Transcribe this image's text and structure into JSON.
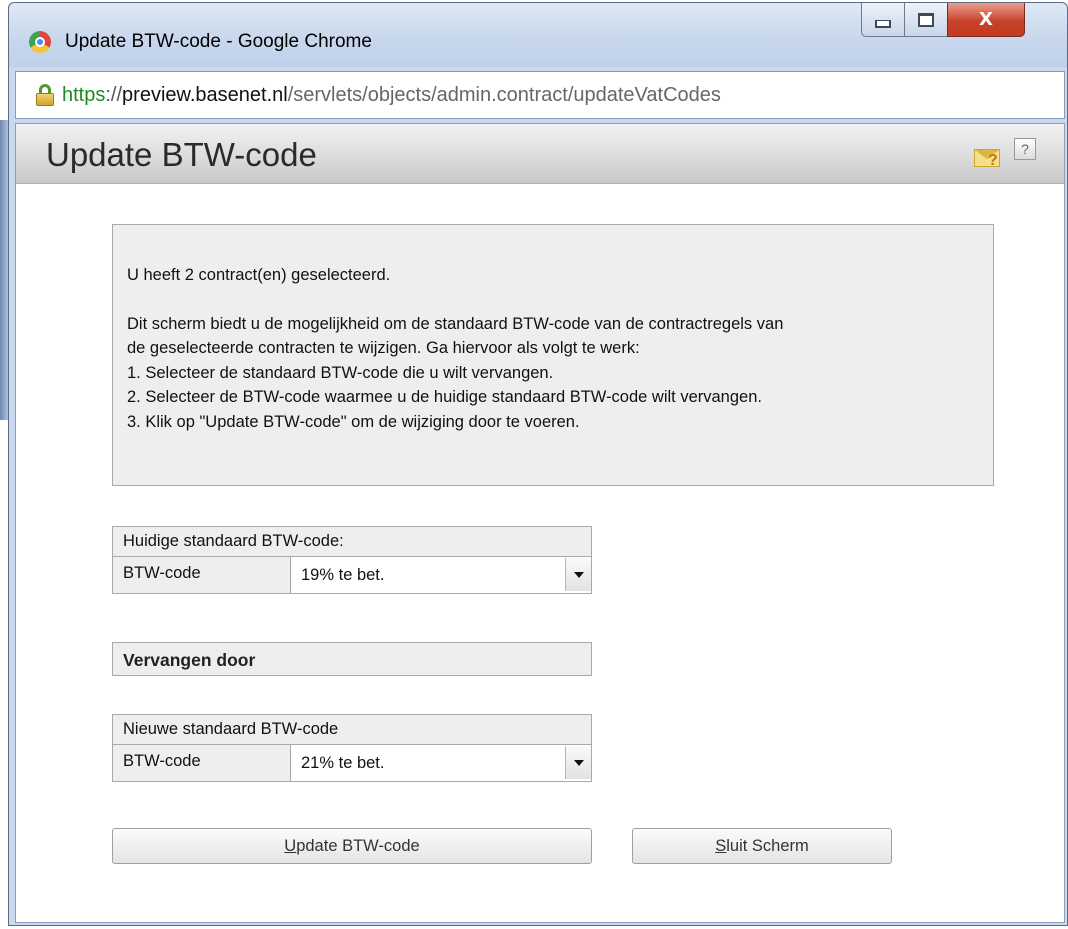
{
  "window": {
    "title": "Update BTW-code - Google Chrome",
    "controls": {
      "minimize": "minimize",
      "maximize": "maximize",
      "close": "X"
    }
  },
  "address_bar": {
    "scheme": "https",
    "separator": "://",
    "host": "preview.basenet.nl",
    "path": "/servlets/objects/admin.contract/updateVatCodes"
  },
  "page": {
    "title": "Update BTW-code",
    "help_label": "?",
    "mail_help_mark": "?"
  },
  "info": {
    "selection_text": "U heeft 2 contract(en) geselecteerd.",
    "intro_line1": "Dit scherm biedt u de mogelijkheid om de standaard BTW-code van de contractregels van",
    "intro_line2": "de geselecteerde contracten te wijzigen. Ga hiervoor als volgt te werk:",
    "step1": "1. Selecteer de standaard BTW-code die u wilt vervangen.",
    "step2": "2. Selecteer de BTW-code waarmee u de huidige standaard BTW-code wilt vervangen.",
    "step3": "3. Klik op \"Update BTW-code\" om de wijziging door te voeren."
  },
  "current_code": {
    "header": "Huidige standaard BTW-code:",
    "label": "BTW-code",
    "selected": "19% te bet."
  },
  "replace_section": {
    "label": "Vervangen door"
  },
  "new_code": {
    "header": "Nieuwe standaard BTW-code",
    "label": "BTW-code",
    "selected": "21% te bet."
  },
  "buttons": {
    "update_mnemonic": "U",
    "update_rest": "pdate BTW-code",
    "close_mnemonic": "S",
    "close_rest": "luit Scherm"
  },
  "icons": {
    "browser": "chrome-icon",
    "lock": "lock-icon",
    "mail_help": "mail-help-icon",
    "help": "help-icon",
    "dropdown": "chevron-down-icon"
  },
  "colors": {
    "titlebar": "#c9d9ef",
    "close_button": "#c8432b",
    "secure_scheme": "#1f8a1f",
    "panel_bg": "#eeeeee",
    "panel_border": "#a9a9a9"
  }
}
